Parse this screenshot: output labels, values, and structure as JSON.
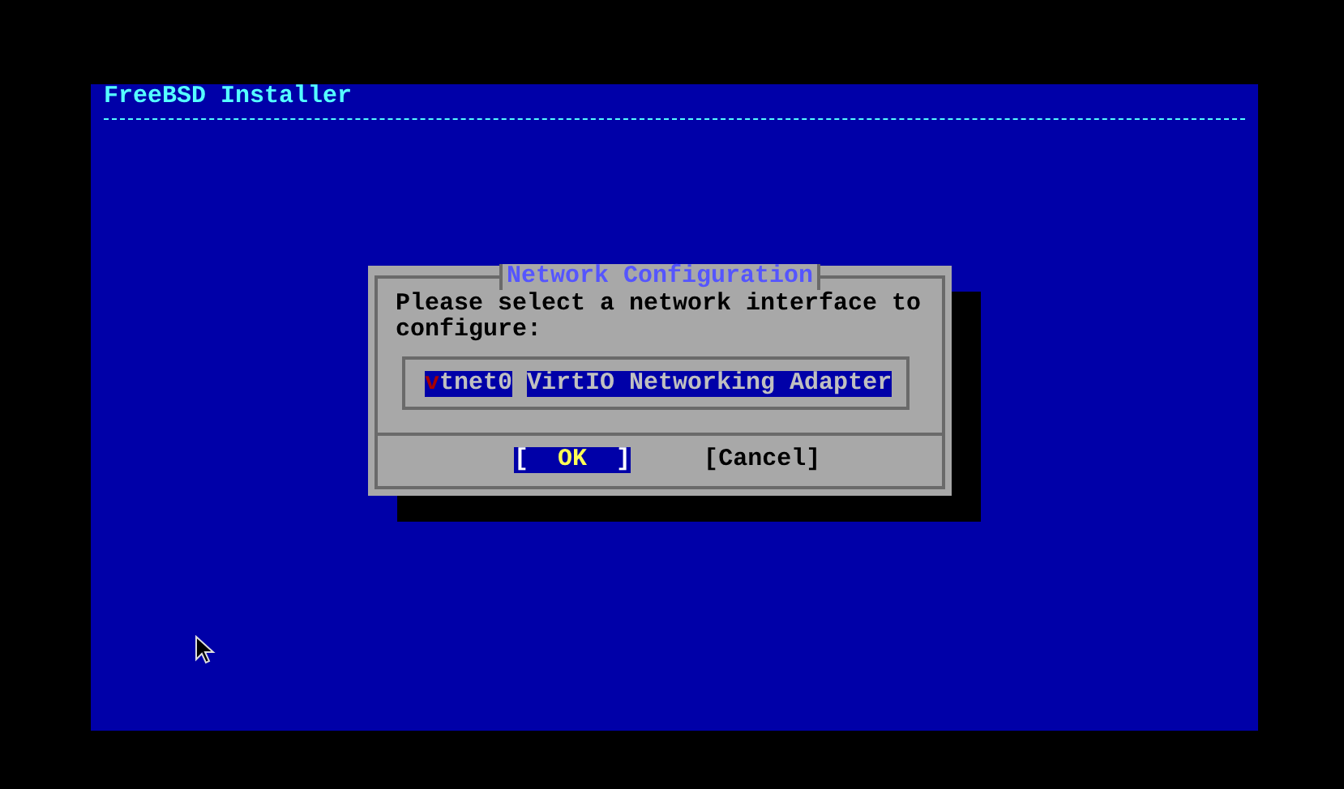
{
  "header": {
    "title": "FreeBSD Installer"
  },
  "dialog": {
    "title": "Network Configuration",
    "prompt": "Please select a network interface to configure:",
    "interfaces": [
      {
        "name": "vtnet0",
        "description": "VirtIO Networking Adapter",
        "selected": true
      }
    ],
    "buttons": [
      {
        "label": "[  OK  ]",
        "selected": true
      },
      {
        "label": "[Cancel]",
        "selected": false
      }
    ]
  }
}
